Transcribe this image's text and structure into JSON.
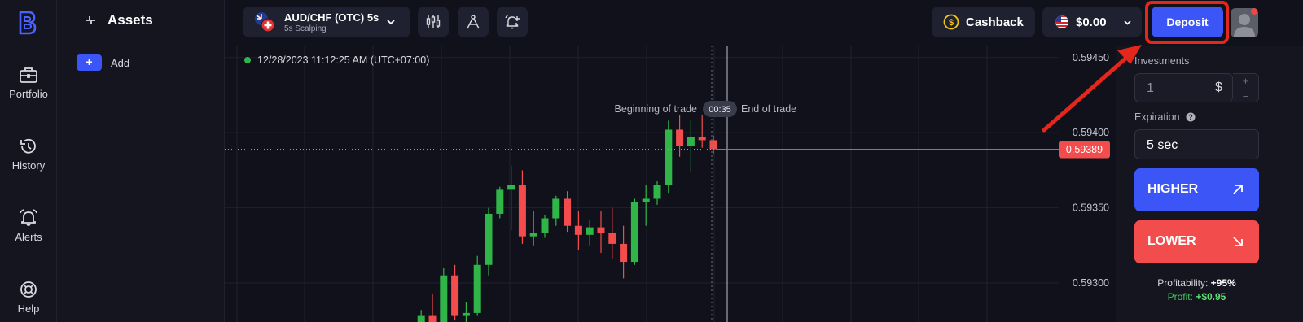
{
  "nav": {
    "items": [
      {
        "label": "Portfolio",
        "icon": "briefcase-icon"
      },
      {
        "label": "History",
        "icon": "history-icon"
      },
      {
        "label": "Alerts",
        "icon": "bell-icon"
      },
      {
        "label": "Help",
        "icon": "lifebuoy-icon"
      }
    ]
  },
  "assets": {
    "title": "Assets",
    "add_label": "Add",
    "add_symbol": "+"
  },
  "topbar": {
    "pair_name": "AUD/CHF (OTC) 5s",
    "pair_sub": "5s Scalping",
    "tools": [
      "indicators-icon",
      "drawing-compass-icon",
      "add-alert-icon"
    ],
    "cashback_label": "Cashback",
    "balance": "$0.00",
    "deposit_label": "Deposit"
  },
  "chart": {
    "timestamp": "12/28/2023 11:12:25 AM",
    "timezone": "(UTC+07:00)",
    "begin_label": "Beginning of trade",
    "end_label": "End of trade",
    "timer": "00:35",
    "current_price_label": "0.59389",
    "up_color": "#2fb548",
    "down_color": "#f34c4c"
  },
  "chart_data": {
    "type": "candlestick",
    "y_ticks": [
      "0.59450",
      "0.59400",
      "0.59350",
      "0.59300"
    ],
    "ylim": [
      0.59274,
      0.59458
    ],
    "current_price": 0.59389,
    "candles": [
      {
        "o": 0.59272,
        "h": 0.59282,
        "l": 0.59268,
        "c": 0.59278
      },
      {
        "o": 0.59278,
        "h": 0.59293,
        "l": 0.59265,
        "c": 0.59272
      },
      {
        "o": 0.59272,
        "h": 0.5931,
        "l": 0.59265,
        "c": 0.59305
      },
      {
        "o": 0.59305,
        "h": 0.59312,
        "l": 0.59275,
        "c": 0.59278
      },
      {
        "o": 0.59278,
        "h": 0.59287,
        "l": 0.5927,
        "c": 0.5928
      },
      {
        "o": 0.5928,
        "h": 0.59318,
        "l": 0.59278,
        "c": 0.59312
      },
      {
        "o": 0.59312,
        "h": 0.5935,
        "l": 0.59305,
        "c": 0.59346
      },
      {
        "o": 0.59346,
        "h": 0.59364,
        "l": 0.59343,
        "c": 0.59362
      },
      {
        "o": 0.59362,
        "h": 0.59378,
        "l": 0.59335,
        "c": 0.59365
      },
      {
        "o": 0.59365,
        "h": 0.59375,
        "l": 0.59326,
        "c": 0.59331
      },
      {
        "o": 0.59331,
        "h": 0.59348,
        "l": 0.59325,
        "c": 0.59333
      },
      {
        "o": 0.59333,
        "h": 0.59345,
        "l": 0.5933,
        "c": 0.59343
      },
      {
        "o": 0.59343,
        "h": 0.59358,
        "l": 0.59338,
        "c": 0.59356
      },
      {
        "o": 0.59356,
        "h": 0.59361,
        "l": 0.59334,
        "c": 0.59338
      },
      {
        "o": 0.59338,
        "h": 0.59348,
        "l": 0.59322,
        "c": 0.59332
      },
      {
        "o": 0.59332,
        "h": 0.59342,
        "l": 0.59325,
        "c": 0.59337
      },
      {
        "o": 0.59337,
        "h": 0.59348,
        "l": 0.5932,
        "c": 0.59333
      },
      {
        "o": 0.59333,
        "h": 0.5935,
        "l": 0.59316,
        "c": 0.59326
      },
      {
        "o": 0.59326,
        "h": 0.59338,
        "l": 0.59303,
        "c": 0.59314
      },
      {
        "o": 0.59314,
        "h": 0.59356,
        "l": 0.59312,
        "c": 0.59354
      },
      {
        "o": 0.59354,
        "h": 0.59365,
        "l": 0.59338,
        "c": 0.59356
      },
      {
        "o": 0.59356,
        "h": 0.59368,
        "l": 0.59352,
        "c": 0.59365
      },
      {
        "o": 0.59365,
        "h": 0.59408,
        "l": 0.5936,
        "c": 0.59402
      },
      {
        "o": 0.59402,
        "h": 0.59412,
        "l": 0.59384,
        "c": 0.59391
      },
      {
        "o": 0.59391,
        "h": 0.59409,
        "l": 0.59374,
        "c": 0.59397
      },
      {
        "o": 0.59397,
        "h": 0.59412,
        "l": 0.5939,
        "c": 0.59395
      },
      {
        "o": 0.59395,
        "h": 0.59398,
        "l": 0.59386,
        "c": 0.59389
      }
    ]
  },
  "trade": {
    "investments_label": "Investments",
    "investment_value": "1",
    "currency": "$",
    "plus": "+",
    "minus": "−",
    "expiration_label": "Expiration",
    "expiration_value": "5 sec",
    "higher_label": "HIGHER",
    "lower_label": "LOWER",
    "profitability_label": "Profitability:",
    "profitability_value": "+95%",
    "profit_label": "Profit:",
    "profit_value": "+$0.95",
    "higher_color": "#3b55f6",
    "lower_color": "#f34c4c"
  },
  "annotation": {
    "highlight_color": "#e5261a"
  }
}
